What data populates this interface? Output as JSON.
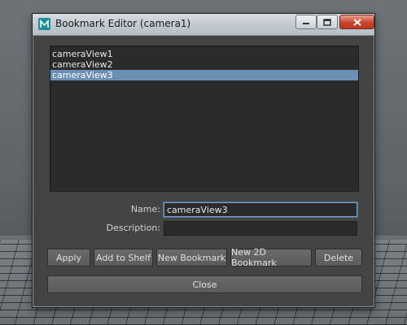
{
  "window": {
    "title": "Bookmark Editor (camera1)",
    "controls": {
      "minimize": "minimize-icon",
      "maximize": "maximize-icon",
      "close": "close-icon"
    }
  },
  "bookmarks": {
    "items": [
      "cameraView1",
      "cameraView2",
      "cameraView3"
    ],
    "selected_index": 2
  },
  "form": {
    "name_label": "Name:",
    "name_value": "cameraView3",
    "description_label": "Description:",
    "description_value": ""
  },
  "buttons": {
    "apply": "Apply",
    "add_to_shelf": "Add to Shelf",
    "new_bookmark": "New Bookmark",
    "new_2d_bookmark": "New 2D Bookmark",
    "delete": "Delete",
    "close": "Close"
  },
  "colors": {
    "selection": "#6b8fb5",
    "panel": "#444444",
    "list_bg": "#2b2b2b",
    "field_focus": "#7aa2c9"
  }
}
